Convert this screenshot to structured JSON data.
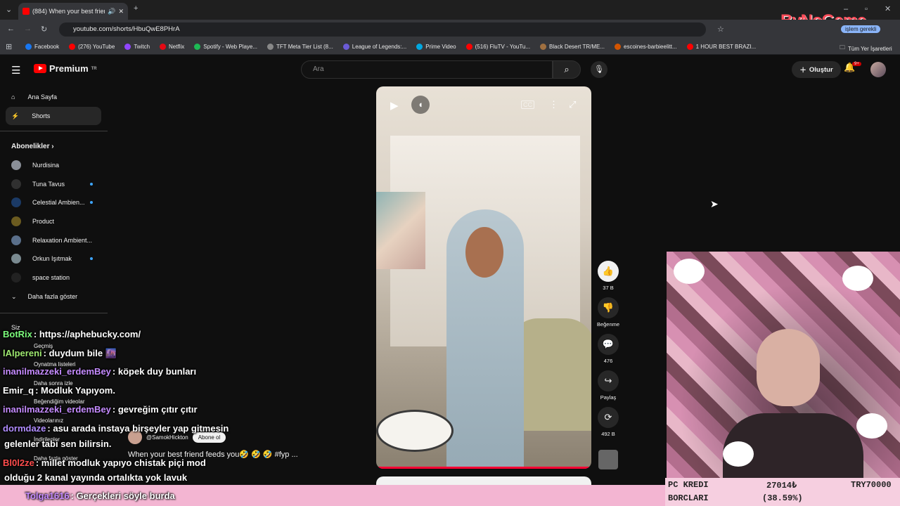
{
  "browser": {
    "tab_title": "(884) When your best frien",
    "url": "youtube.com/shorts/HbuQwE8PHrA",
    "profile_label": "işlem gerekli",
    "bookmarks": [
      "Facebook",
      "(276) YouTube",
      "Twitch",
      "Netflix",
      "Spotify - Web Playe...",
      "TFT Meta Tier List (8...",
      "League of Legends:...",
      "Prime Video",
      "(516) FluTV - YouTu...",
      "Black Desert TR/ME...",
      "escoines-barbieelitt...",
      "1 HOUR BEST BRAZI..."
    ],
    "bookmarks_folder": "Tüm Yer İşaretleri",
    "bookmark_colors": [
      "#1877f2",
      "#ff0000",
      "#9146ff",
      "#e50914",
      "#1db954",
      "#888888",
      "#6b5bd6",
      "#00a8e1",
      "#ff0000",
      "#a07040",
      "#d35400",
      "#ff0000"
    ]
  },
  "watermark": "ByNoGame",
  "header": {
    "logo": "Premium",
    "logo_region": "TR",
    "search_placeholder": "Ara",
    "create_label": "Oluştur",
    "notif_badge": "9+"
  },
  "sidebar": {
    "items": [
      {
        "label": "Ana Sayfa",
        "icon": "home-icon"
      },
      {
        "label": "Shorts",
        "icon": "shorts-icon",
        "active": true
      }
    ],
    "subs_heading": "Abonelikler",
    "subscriptions": [
      {
        "label": "Nurdisina",
        "dot": false,
        "color": "#8a8f98"
      },
      {
        "label": "Tuna Tavus",
        "dot": true,
        "color": "#303030"
      },
      {
        "label": "Celestial Ambien...",
        "dot": true,
        "color": "#1b3a66"
      },
      {
        "label": "Product",
        "dot": false,
        "color": "#6b5b20"
      },
      {
        "label": "Relaxation Ambient...",
        "dot": false,
        "color": "#5a6f8a"
      },
      {
        "label": "Orkun Işıtmak",
        "dot": true,
        "color": "#7a8a90"
      },
      {
        "label": "space station",
        "dot": false,
        "color": "#222222"
      }
    ],
    "more_label": "Daha fazla göster",
    "you_heading": "Siz",
    "you_items": [
      "Geçmiş",
      "Oynatma listeleri",
      "Daha sonra izle",
      "Beğendiğim videolar",
      "Videolarınız",
      "İndirilenler",
      "Daha fazla göster"
    ]
  },
  "short": {
    "channel": "@SamokHickton",
    "subscribe_label": "Abone ol",
    "title": "When your best friend feeds you🤣 🤣 🤣 #fyp ...",
    "actions": [
      {
        "name": "like-button",
        "icon": "👍",
        "label": "37 B"
      },
      {
        "name": "dislike-button",
        "icon": "👎",
        "label": "Beğenme"
      },
      {
        "name": "comments-button",
        "icon": "💬",
        "label": "476"
      },
      {
        "name": "share-button",
        "icon": "↪",
        "label": "Paylaş"
      },
      {
        "name": "remix-button",
        "icon": "⟳",
        "label": "492 B"
      }
    ]
  },
  "chat": [
    {
      "user": "BotRix",
      "color": "#7cfc7c",
      "text": ": https://aphebucky.com/"
    },
    {
      "user": "lAlpereni",
      "color": "#9fe870",
      "text": ": duydum bile 🌆"
    },
    {
      "user": "inanilmazzeki_erdemBey",
      "color": "#c58bff",
      "text": ": köpek duy bunları"
    },
    {
      "user": "Emir_q",
      "color": "#ffffff",
      "text": ": Modluk Yapıyom."
    },
    {
      "user": "inanilmazzeki_erdemBey",
      "color": "#c58bff",
      "text": ": gevreğim çıtır çıtır"
    },
    {
      "user": "dormdaze",
      "color": "#b08cff",
      "text": ": asu arada instaya birşeyler yap gitmesin"
    },
    {
      "user": "",
      "color": "#ffffff",
      "text": "gelenler tabi sen bilirsin."
    },
    {
      "user": "Bl0l2ze",
      "color": "#ff4d4d",
      "text": ": millet modluk yapıyo chistak piçi mod"
    },
    {
      "user": "",
      "color": "#ffffff",
      "text": "olduğu 2 kanal yayında ortalıkta yok lavuk"
    },
    {
      "user": "Tolga1616",
      "color": "#c58bff",
      "text": ": Gerçekleri söyle burda"
    }
  ],
  "overlay": {
    "kredi_label1": "PC KREDI",
    "kredi_label2": "BORCLARI",
    "amount": "27014₺",
    "percent": "(38.59%)",
    "target": "TRY70000"
  }
}
